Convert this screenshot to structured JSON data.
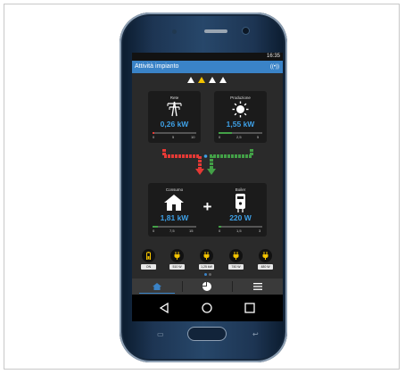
{
  "status_bar": {
    "time": "16:35"
  },
  "app_bar": {
    "title": "Attività impianto",
    "signal_icon": "broadcast-icon",
    "color": "#3a83c7"
  },
  "alerts": [
    {
      "icon": "warning-icon",
      "color": "#ffffff"
    },
    {
      "icon": "warning-icon",
      "color": "#f2c200"
    },
    {
      "icon": "warning-icon",
      "color": "#ffffff"
    },
    {
      "icon": "warning-icon",
      "color": "#ffffff"
    }
  ],
  "cards": {
    "rete": {
      "label": "Rete",
      "icon": "power-pylon-icon",
      "value": "0,26 kW",
      "ticks": [
        "0",
        "5",
        "10"
      ],
      "bar_fraction": 0.05,
      "bar_color": "#e53935"
    },
    "produzione": {
      "label": "Produzione",
      "icon": "sun-icon",
      "value": "1,55 kW",
      "ticks": [
        "0",
        "2,5",
        "5"
      ],
      "bar_fraction": 0.31,
      "bar_color": "#43a047"
    },
    "consumo": {
      "label": "Consumo",
      "icon": "house-icon",
      "value": "1,81 kW",
      "ticks": [
        "0",
        "7,5",
        "15"
      ],
      "bar_fraction": 0.12,
      "bar_color": "#43a047"
    },
    "boiler": {
      "label": "Boiler",
      "icon": "boiler-icon",
      "value": "220 W",
      "ticks": [
        "0",
        "1,5",
        "3"
      ],
      "bar_fraction": 0.07,
      "bar_color": "#43a047"
    }
  },
  "plus_sign": "+",
  "flow_colors": {
    "grid": "#e53935",
    "solar": "#43a047"
  },
  "devices": [
    {
      "icon": "battery-icon",
      "label": "ON"
    },
    {
      "icon": "plug-icon",
      "label": "510 W"
    },
    {
      "icon": "plug-icon",
      "label": "1,25 kW"
    },
    {
      "icon": "plug-icon",
      "label": "740 W"
    },
    {
      "icon": "plug-icon",
      "label": "480 W"
    }
  ],
  "page_dots": {
    "active": 0,
    "count": 2
  },
  "tabs": [
    {
      "icon": "home-icon",
      "active": true
    },
    {
      "icon": "pie-chart-icon",
      "active": false
    },
    {
      "icon": "menu-icon",
      "active": false
    }
  ],
  "nav": [
    {
      "icon": "back-icon"
    },
    {
      "icon": "home-circle-icon"
    },
    {
      "icon": "recents-icon"
    }
  ]
}
